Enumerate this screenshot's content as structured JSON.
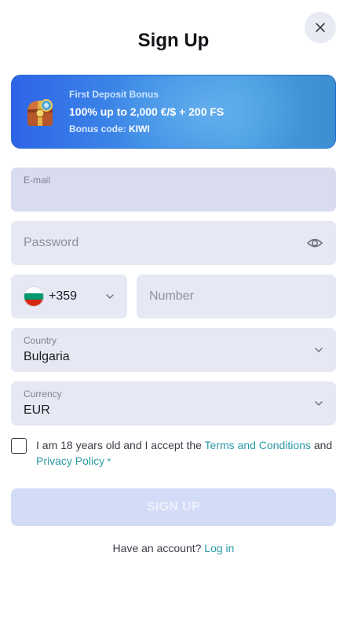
{
  "header": {
    "title": "Sign Up",
    "close_icon": "close-icon"
  },
  "bonus": {
    "heading": "First Deposit Bonus",
    "offer": "100% up to 2,000 €/$ + 200 FS",
    "code_label": "Bonus code: ",
    "code": "KIWI",
    "icon": "treasure-chest-icon"
  },
  "form": {
    "email": {
      "label": "E-mail",
      "value": ""
    },
    "password": {
      "placeholder": "Password",
      "icon": "eye-icon"
    },
    "phone": {
      "country_flag": "bulgaria-flag-icon",
      "code": "+359",
      "number_placeholder": "Number"
    },
    "country": {
      "label": "Country",
      "value": "Bulgaria"
    },
    "currency": {
      "label": "Currency",
      "value": "EUR"
    },
    "terms": {
      "prefix": "I am 18 years old and I accept the ",
      "terms_link": "Terms and Conditions",
      "middle": " and ",
      "privacy_link": "Privacy Policy",
      "required_mark": " *"
    },
    "submit_label": "SIGN UP"
  },
  "footer": {
    "prompt": "Have an account? ",
    "login_link": "Log in"
  },
  "colors": {
    "accent_link": "#2b9aa7",
    "field_bg": "#e6e9f4",
    "submit_disabled": "#d3dcf7",
    "bonus_blue": "#2e64e8"
  }
}
